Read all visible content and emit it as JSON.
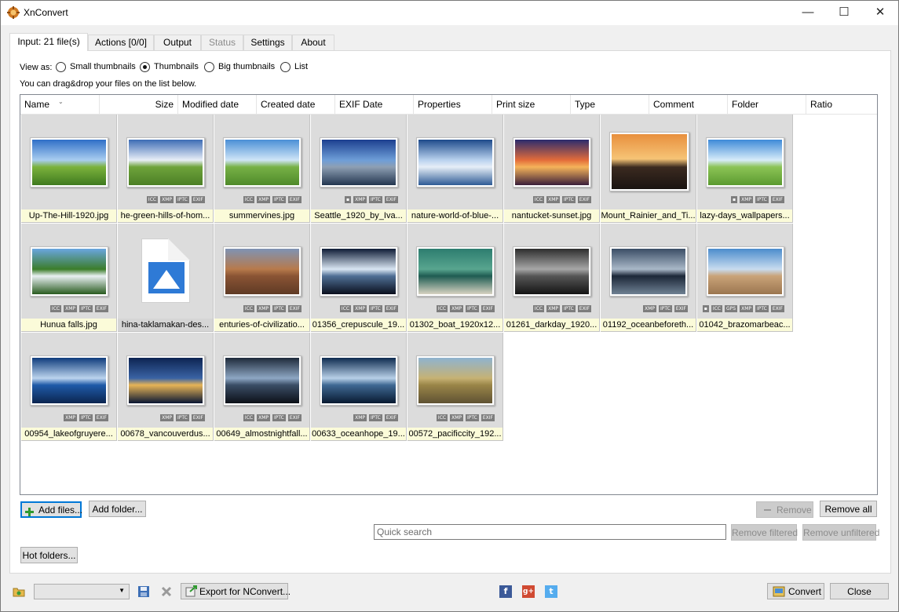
{
  "window": {
    "title": "XnConvert",
    "controls": {
      "minimize": "—",
      "maximize": "☐",
      "close": "✕"
    }
  },
  "tabs": [
    {
      "label": "Input: 21 file(s)",
      "state": "active"
    },
    {
      "label": "Actions [0/0]",
      "state": "normal"
    },
    {
      "label": "Output",
      "state": "normal"
    },
    {
      "label": "Status",
      "state": "disabled"
    },
    {
      "label": "Settings",
      "state": "normal"
    },
    {
      "label": "About",
      "state": "normal"
    }
  ],
  "view_as": {
    "label": "View as:",
    "options": [
      "Small thumbnails",
      "Thumbnails",
      "Big thumbnails",
      "List"
    ],
    "selected": "Thumbnails"
  },
  "hint": "You can drag&drop your files on the list below.",
  "columns": [
    "Name",
    "Size",
    "Modified date",
    "Created date",
    "EXIF Date",
    "Properties",
    "Print size",
    "Type",
    "Comment",
    "Folder",
    "Ratio"
  ],
  "files": [
    {
      "name": "Up-The-Hill-1920.jpg",
      "badges": [],
      "palette": [
        "#2f6fc7",
        "#a9cdf0",
        "#7bb23c",
        "#3f7a1f"
      ]
    },
    {
      "name": "he-green-hills-of-hom...",
      "badges": [
        "ICC",
        "XMP",
        "IPTC",
        "EXIF"
      ],
      "palette": [
        "#3d6cb5",
        "#e8eef7",
        "#6ea33b",
        "#4c7f25"
      ]
    },
    {
      "name": "summervines.jpg",
      "badges": [
        "ICC",
        "XMP",
        "IPTC",
        "EXIF"
      ],
      "palette": [
        "#4a8fd6",
        "#cfe5f7",
        "#77b146",
        "#4f8a2a"
      ]
    },
    {
      "name": "Seattle_1920_by_Iva...",
      "badges": [
        "▪",
        "XMP",
        "IPTC",
        "EXIF"
      ],
      "palette": [
        "#1c3f8f",
        "#6e9ed8",
        "#8e9fb3",
        "#233650"
      ]
    },
    {
      "name": "nature-world-of-blue-...",
      "badges": [],
      "palette": [
        "#1e4a8b",
        "#b9d2ee",
        "#e6eef7",
        "#2d5a95"
      ]
    },
    {
      "name": "nantucket-sunset.jpg",
      "badges": [
        "ICC",
        "XMP",
        "IPTC",
        "EXIF"
      ],
      "palette": [
        "#2b2c6e",
        "#e36c3a",
        "#f5b35a",
        "#3a1e3a"
      ]
    },
    {
      "name": "Mount_Rainier_and_Ti...",
      "badges": [],
      "palette": [
        "#e88f3d",
        "#f6c476",
        "#3b2a20",
        "#1a1411"
      ]
    },
    {
      "name": "lazy-days_wallpapers...",
      "badges": [
        "▪",
        "XMP",
        "IPTC",
        "EXIF"
      ],
      "palette": [
        "#3e8ad8",
        "#d7ecf9",
        "#8cc456",
        "#5b9a30"
      ]
    },
    {
      "name": "Hunua falls.jpg",
      "badges": [
        "ICC",
        "XMP",
        "IPTC",
        "EXIF"
      ],
      "palette": [
        "#6aa6df",
        "#3b7d2a",
        "#e9f0f3",
        "#295b1f"
      ]
    },
    {
      "name": "hina-taklamakan-des...",
      "badges": [],
      "palette": [],
      "placeholder": true
    },
    {
      "name": "enturies-of-civilizatio...",
      "badges": [
        "ICC",
        "XMP",
        "IPTC",
        "EXIF"
      ],
      "palette": [
        "#7f93b4",
        "#b77a4b",
        "#8a5434",
        "#5f3a25"
      ]
    },
    {
      "name": "01356_crepuscule_19...",
      "badges": [
        "ICC",
        "XMP",
        "IPTC",
        "EXIF"
      ],
      "palette": [
        "#0f1c36",
        "#d9e6f3",
        "#4f6f95",
        "#0a0f1d"
      ]
    },
    {
      "name": "01302_boat_1920x12...",
      "badges": [
        "ICC",
        "XMP",
        "IPTC",
        "EXIF"
      ],
      "palette": [
        "#2d7d6f",
        "#58a58f",
        "#1f5c52",
        "#d8d3c2"
      ]
    },
    {
      "name": "01261_darkday_1920...",
      "badges": [
        "ICC",
        "XMP",
        "IPTC",
        "EXIF"
      ],
      "palette": [
        "#2d2d2d",
        "#a7a7a7",
        "#565656",
        "#141414"
      ]
    },
    {
      "name": "01192_oceanbeforeth...",
      "badges": [
        "XMP",
        "IPTC",
        "EXIF"
      ],
      "palette": [
        "#3b4e66",
        "#a9b8c8",
        "#1c2738",
        "#6f8193"
      ]
    },
    {
      "name": "01042_brazomarbeac...",
      "badges": [
        "▪",
        "ICC",
        "GPS",
        "XMP",
        "IPTC",
        "EXIF"
      ],
      "palette": [
        "#4b8ccc",
        "#c8dcef",
        "#c9a378",
        "#9b7650"
      ]
    },
    {
      "name": "00954_lakeofgruyere...",
      "badges": [
        "XMP",
        "IPTC",
        "EXIF"
      ],
      "palette": [
        "#0f3c7c",
        "#bcd4ee",
        "#1f5aa8",
        "#0b2550"
      ]
    },
    {
      "name": "00678_vancouverdus...",
      "badges": [
        "XMP",
        "IPTC",
        "EXIF"
      ],
      "palette": [
        "#0d2452",
        "#3a63a4",
        "#e7b457",
        "#081633"
      ]
    },
    {
      "name": "00649_almostnightfall...",
      "badges": [
        "ICC",
        "XMP",
        "IPTC",
        "EXIF"
      ],
      "palette": [
        "#1e2a3a",
        "#8ea7c4",
        "#3a4d65",
        "#0c1018"
      ]
    },
    {
      "name": "00633_oceanhope_19...",
      "badges": [
        "XMP",
        "IPTC",
        "EXIF"
      ],
      "palette": [
        "#0e2b4f",
        "#b8d0e8",
        "#3f6893",
        "#081a31"
      ]
    },
    {
      "name": "00572_pacificcity_192...",
      "badges": [
        "ICC",
        "XMP",
        "IPTC",
        "EXIF"
      ],
      "palette": [
        "#8fb3cf",
        "#c6b274",
        "#9a8548",
        "#5f5233"
      ]
    }
  ],
  "buttons": {
    "add_files": "Add files...",
    "add_folder": "Add folder...",
    "remove": "Remove",
    "remove_all": "Remove all",
    "remove_filtered": "Remove filtered",
    "remove_unfiltered": "Remove unfiltered",
    "hot_folders": "Hot folders...",
    "export": "Export for NConvert...",
    "convert": "Convert",
    "close": "Close"
  },
  "search": {
    "placeholder": "Quick search"
  },
  "social": {
    "facebook": "f",
    "google": "g+",
    "twitter": "t"
  },
  "colors": {
    "accent": "#0078d7",
    "filename_bg": "#fbfbd9",
    "cell_bg": "#dcdcdc"
  }
}
